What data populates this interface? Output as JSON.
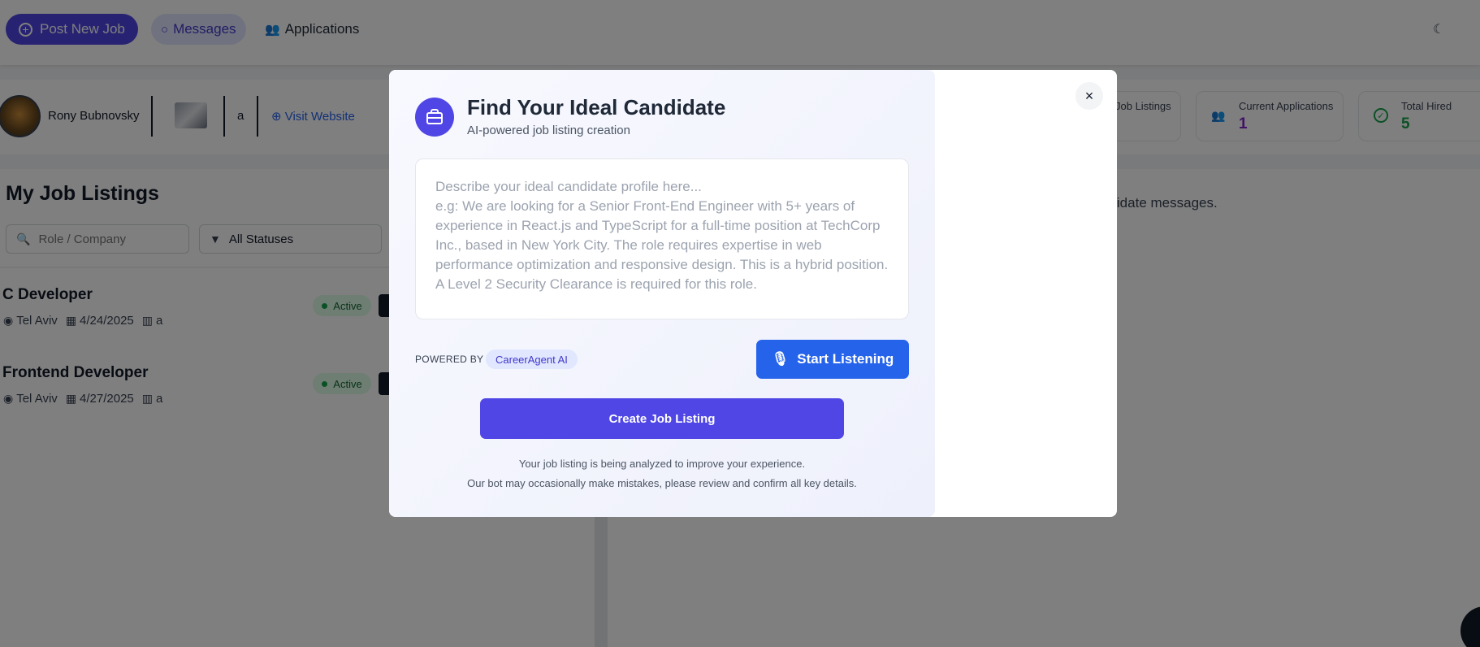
{
  "nav": {
    "post_job": "Post New Job",
    "messages": "Messages",
    "applications": "Applications"
  },
  "profile": {
    "name": "Rony Bubnovsky",
    "company": "a",
    "visit": "Visit Website"
  },
  "stats": [
    {
      "label": "Job Listings",
      "value": ""
    },
    {
      "label": "Current Applications",
      "value": "1"
    },
    {
      "label": "Total Hired",
      "value": "5"
    }
  ],
  "listings": {
    "title": "My Job Listings",
    "search_placeholder": "Role / Company",
    "status_filter": "All Statuses",
    "jobs": [
      {
        "title": "C Developer",
        "location": "Tel Aviv",
        "date": "4/24/2025",
        "company": "a",
        "status": "Active"
      },
      {
        "title": "Frontend Developer",
        "location": "Tel Aviv",
        "date": "4/27/2025",
        "company": "a",
        "status": "Active"
      }
    ]
  },
  "messages_panel": {
    "text": "ndidate messages."
  },
  "modal": {
    "title": "Find Your Ideal Candidate",
    "subtitle": "AI-powered job listing creation",
    "placeholder": "Describe your ideal candidate profile here...\ne.g: We are looking for a Senior Front-End Engineer with 5+ years of experience in React.js and TypeScript for a full-time position at TechCorp Inc., based in New York City. The role requires expertise in web performance optimization and responsive design. This is a hybrid position. A Level 2 Security Clearance is required for this role.",
    "powered_by": "POWERED BY",
    "ai_name": "CareerAgent AI",
    "listen": "Start Listening",
    "create": "Create Job Listing",
    "note1": "Your job listing is being analyzed to improve your experience.",
    "note2": "Our bot may occasionally make mistakes, please review and confirm all key details.",
    "close": "×"
  },
  "colors": {
    "primary": "#4f46e5",
    "blue": "#2563eb",
    "success": "#16a34a",
    "purple": "#7e22ce"
  }
}
